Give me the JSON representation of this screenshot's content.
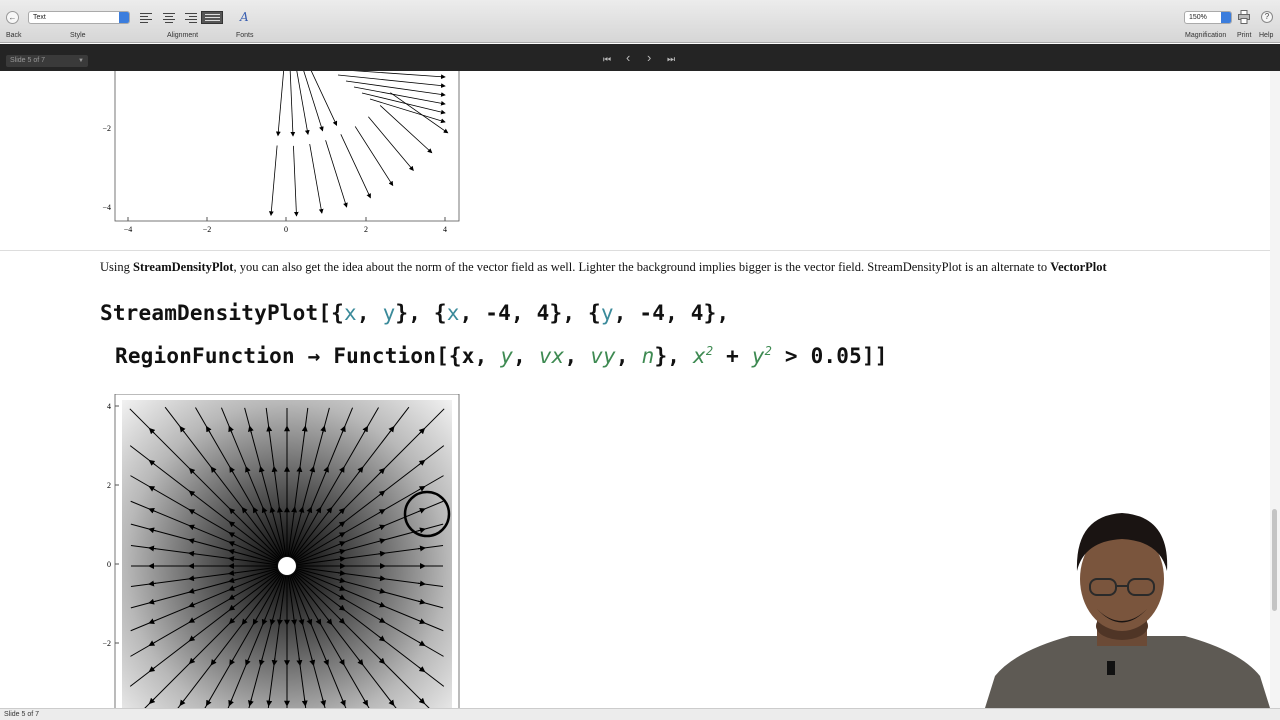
{
  "toolbar": {
    "back_label": "Back",
    "style_label": "Style",
    "style_value": "Text",
    "alignment_label": "Alignment",
    "fonts_label": "Fonts",
    "fonts_glyph": "A",
    "magnification_label": "Magnification",
    "magnification_value": "150%",
    "print_label": "Print",
    "help_label": "Help",
    "help_glyph": "?"
  },
  "navigation": {
    "slide_selector": "Slide 5 of 7",
    "first_glyph": "⏮",
    "prev_glyph": "‹",
    "next_glyph": "›",
    "last_glyph": "⏭"
  },
  "top_plot": {
    "x_ticks": [
      "−4",
      "−2",
      "0",
      "2",
      "4"
    ],
    "y_ticks": [
      "−2",
      "−4"
    ]
  },
  "description": {
    "part1": "Using ",
    "bold1": "StreamDensityPlot",
    "part2": ", you can also get the idea about the norm of the vector field as well. Lighter the background implies bigger is the vector field. StreamDensityPlot is an alternate to ",
    "bold2": "VectorPlot"
  },
  "code": {
    "line1_func": "StreamDensityPlot",
    "line1_a": "[{",
    "x": "x",
    "y": "y",
    "sep": ", ",
    "line1_b": "}, {",
    "range": ", -4, 4}",
    "line1_c": ", {",
    "line1_end": ",",
    "line2_opt": "RegionFunction",
    "arrow": " → ",
    "line2_func": "Function",
    "line2_a": "[{",
    "vx": "vx",
    "vy": "vy",
    "n": "n",
    "line2_b": "}, ",
    "sq": "2",
    "plus": " + ",
    "tail": " > 0.05]]"
  },
  "bottom_plot": {
    "y_ticks": [
      "4",
      "2",
      "0",
      "−2"
    ]
  },
  "status_bar": "Slide 5 of 7",
  "colors": {
    "symbol_teal": "#3a8a9a",
    "italic_green": "#3e8a52",
    "nav_bar": "#242424"
  }
}
